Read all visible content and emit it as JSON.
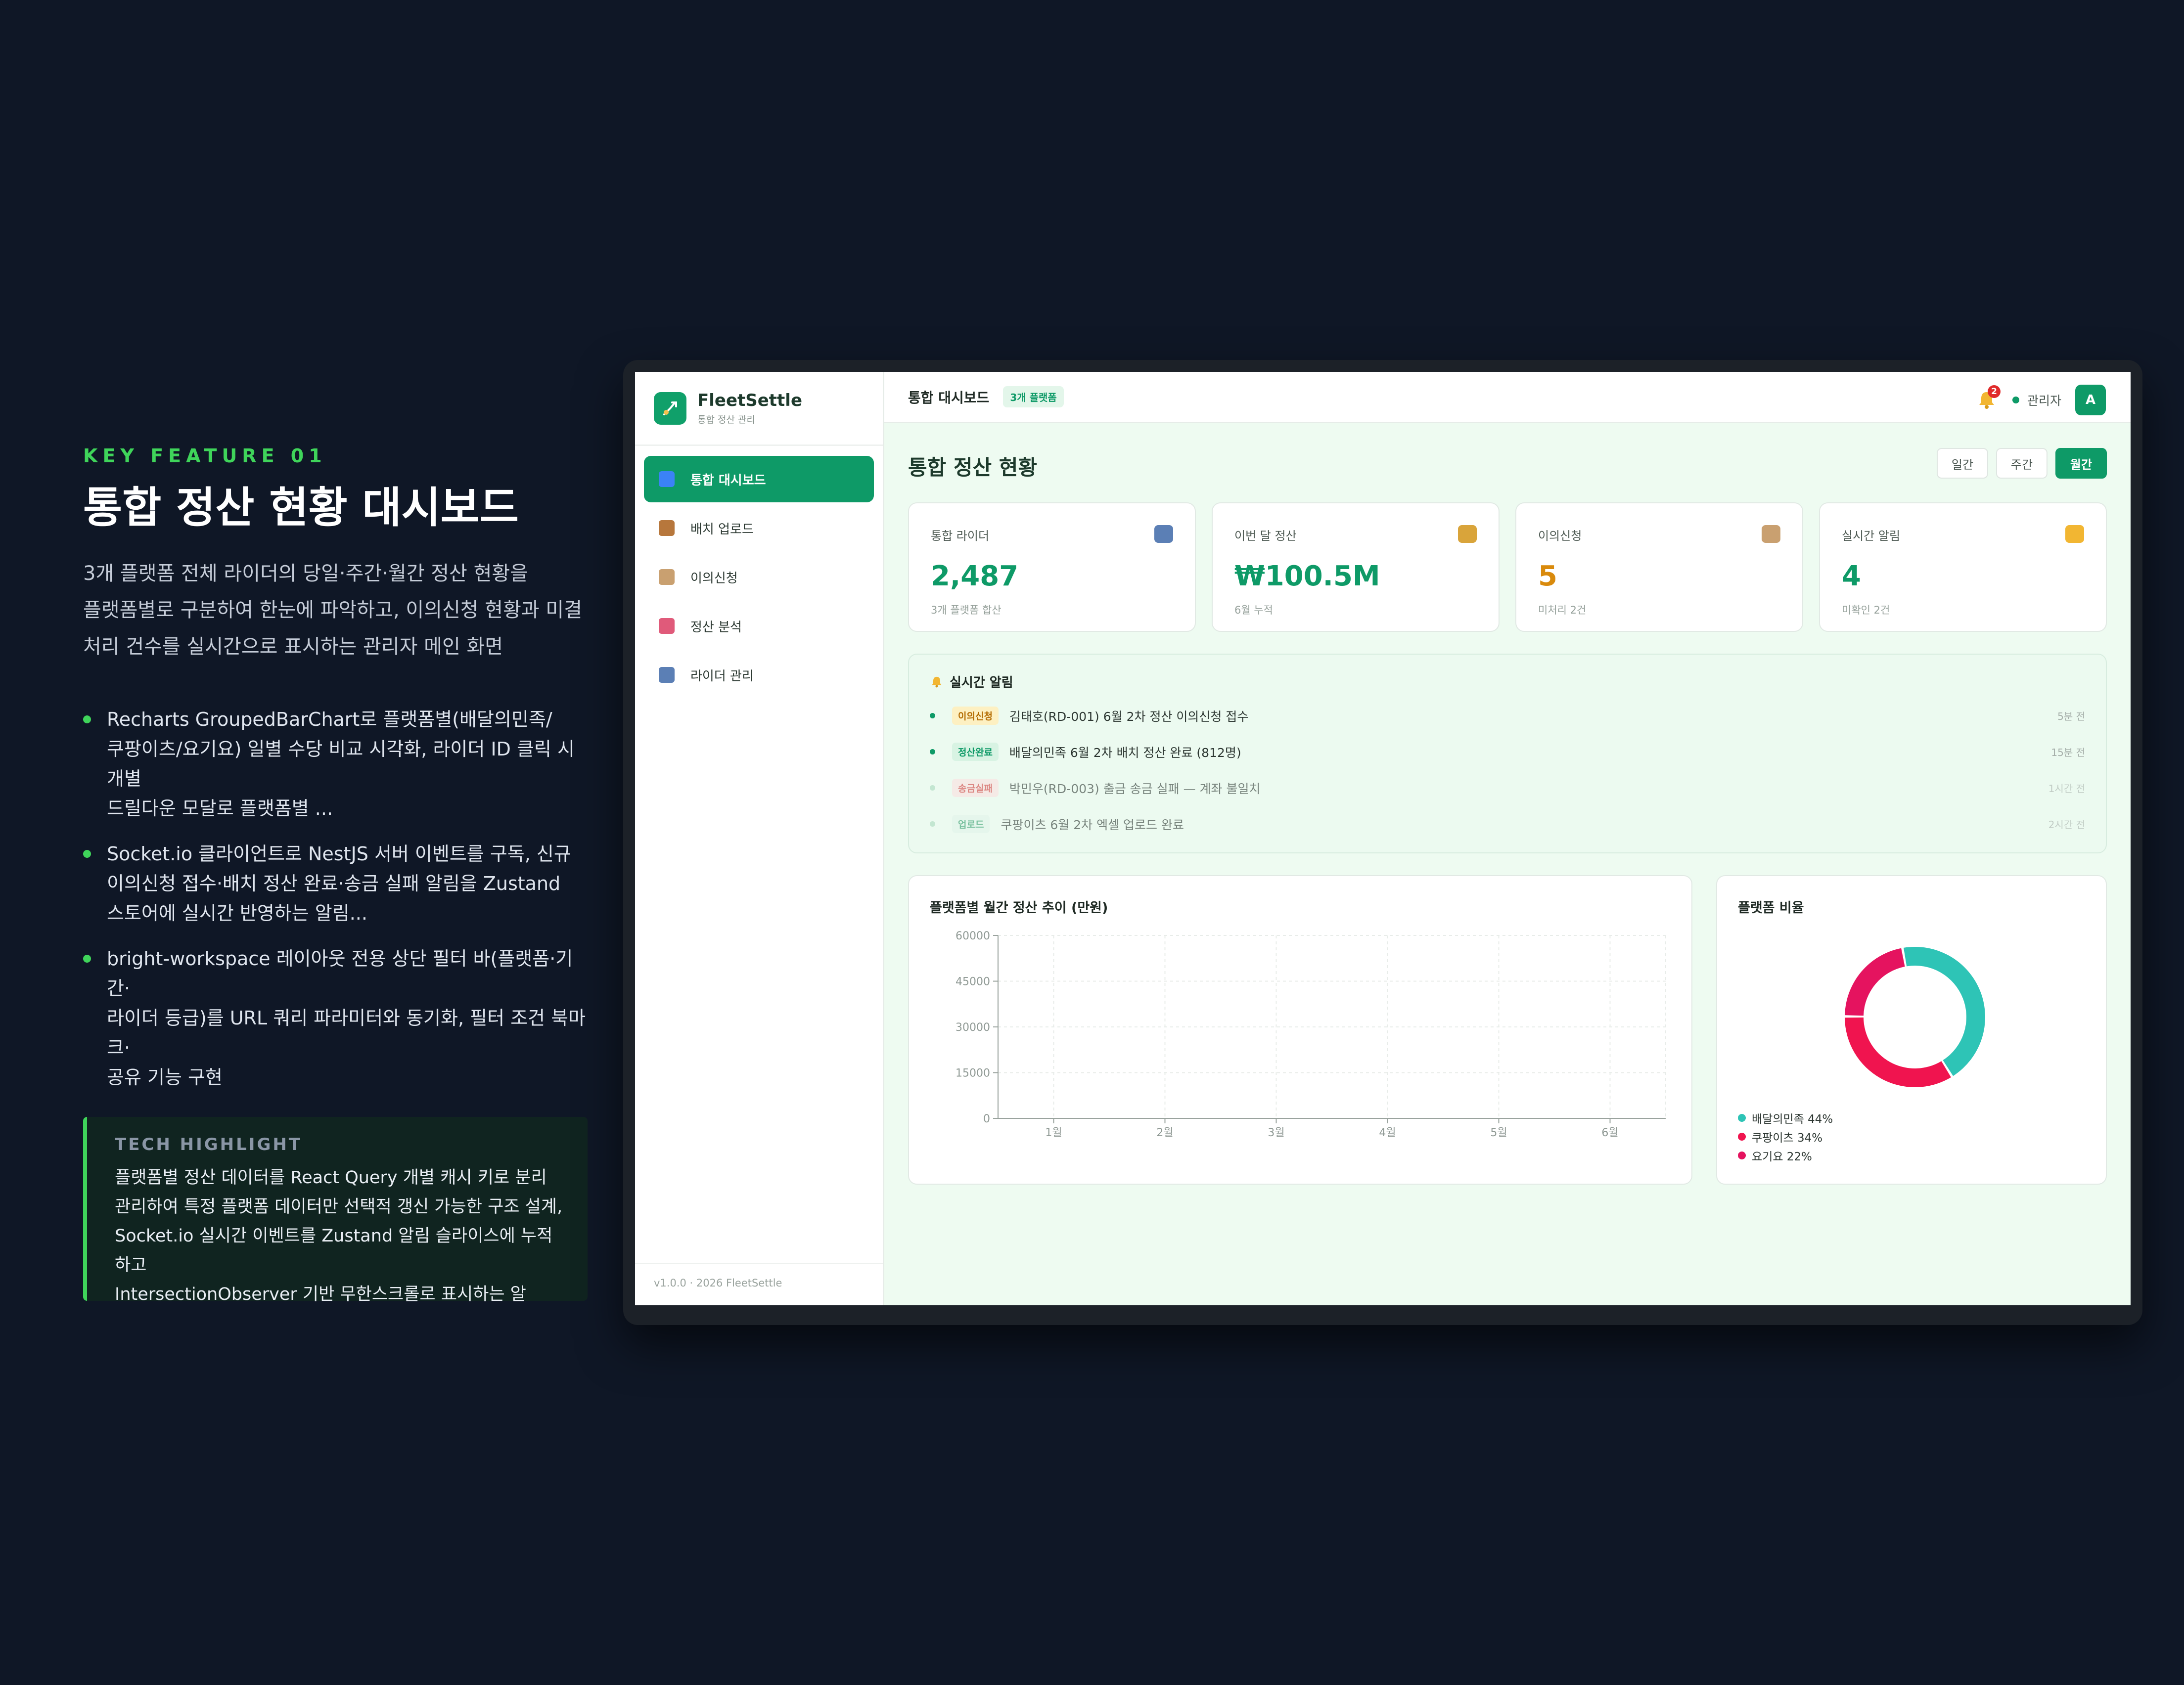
{
  "feature": {
    "kicker": "KEY FEATURE 01",
    "title": "통합 정산 현황 대시보드",
    "desc_lines": [
      "3개 플랫폼 전체 라이더의 당일·주간·월간 정산 현황을",
      "플랫폼별로 구분하여 한눈에 파악하고, 이의신청 현황과 미결",
      "처리 건수를 실시간으로 표시하는 관리자 메인 화면"
    ],
    "bullets": [
      [
        "Recharts GroupedBarChart로 플랫폼별(배달의민족/",
        "쿠팡이츠/요기요) 일별 수당 비교 시각화, 라이더 ID 클릭 시 개별",
        "드릴다운 모달로 플랫폼별 ..."
      ],
      [
        "Socket.io 클라이언트로 NestJS 서버 이벤트를 구독, 신규",
        "이의신청 접수·배치 정산 완료·송금 실패 알림을 Zustand",
        "스토어에 실시간 반영하는 알림..."
      ],
      [
        "bright-workspace 레이아웃 전용 상단 필터 바(플랫폼·기간·",
        "라이더 등급)를 URL 쿼리 파라미터와 동기화, 필터 조건 북마크·",
        "공유 기능 구현"
      ]
    ],
    "tech_title": "TECH HIGHLIGHT",
    "tech_lines": [
      "플랫폼별 정산 데이터를 React Query 개별 캐시 키로 분리",
      "관리하여 특정 플랫폼 데이터만 선택적 갱신 가능한 구조 설계,",
      "Socket.io 실시간 이벤트를 Zustand 알림 슬라이스에 누적하고",
      "IntersectionObserver 기반 무한스크롤로 표시하는 알"
    ]
  },
  "app": {
    "brand": "FleetSettle",
    "brand_sub": "통합 정산 관리",
    "nav": [
      {
        "label": "통합 대시보드",
        "icon": "bar-chart-icon",
        "color": "#3b82f6",
        "active": true
      },
      {
        "label": "배치 업로드",
        "icon": "package-icon",
        "color": "#b7773c",
        "active": false
      },
      {
        "label": "이의신청",
        "icon": "clipboard-icon",
        "color": "#c9a070",
        "active": false
      },
      {
        "label": "정산 분석",
        "icon": "trend-chart-icon",
        "color": "#e05a7a",
        "active": false
      },
      {
        "label": "라이더 관리",
        "icon": "users-icon",
        "color": "#5b7fb5",
        "active": false
      }
    ],
    "footer": "v1.0.0 · 2026 FleetSettle",
    "topbar": {
      "title": "통합 대시보드",
      "badge": "3개 플랫폼",
      "notif_count": "2",
      "user": "관리자",
      "avatar": "A"
    },
    "page_title": "통합 정산 현황",
    "range": [
      {
        "label": "일간",
        "active": false
      },
      {
        "label": "주간",
        "active": false
      },
      {
        "label": "월간",
        "active": true
      }
    ],
    "kpis": [
      {
        "label": "통합 라이더",
        "value": "2,487",
        "sub": "3개 플랫폼 합산",
        "color": "#0e9a67",
        "icon": "users-icon"
      },
      {
        "label": "이번 달 정산",
        "value": "₩100.5M",
        "sub": "6월 누적",
        "color": "#0e9a67",
        "icon": "money-bag-icon"
      },
      {
        "label": "이의신청",
        "value": "5",
        "sub": "미처리 2건",
        "color": "#d98a0c",
        "icon": "clipboard-icon"
      },
      {
        "label": "실시간 알림",
        "value": "4",
        "sub": "미확인 2건",
        "color": "#0e9a67",
        "icon": "bell-icon"
      }
    ],
    "alerts": {
      "title": "실시간 알림",
      "items": [
        {
          "tag": "이의신청",
          "text": "김태호(RD-001) 6월 2차 정산 이의신청 접수",
          "time": "5분 전",
          "tag_bg": "#fdf0c2",
          "tag_fg": "#b36b00",
          "dot": "#0e9a67",
          "muted": false
        },
        {
          "tag": "정산완료",
          "text": "배달의민족 6월 2차 배치 정산 완료 (812명)",
          "time": "15분 전",
          "tag_bg": "#d8f3e3",
          "tag_fg": "#0e9a67",
          "dot": "#0e9a67",
          "muted": false
        },
        {
          "tag": "송금실패",
          "text": "박민우(RD-003) 출금 송금 실패 — 계좌 불일치",
          "time": "1시간 전",
          "tag_bg": "#fbe0e0",
          "tag_fg": "#d23c3c",
          "dot": "#a8d9bd",
          "muted": true
        },
        {
          "tag": "업로드",
          "text": "쿠팡이츠 6월 2차 엑셀 업로드 완료",
          "time": "2시간 전",
          "tag_bg": "#e2f4ea",
          "tag_fg": "#2f9c6a",
          "dot": "#a8d9bd",
          "muted": true
        }
      ]
    }
  },
  "chart_data": [
    {
      "type": "bar",
      "title": "플랫폼별 월간 정산 추이 (만원)",
      "categories": [
        "1월",
        "2월",
        "3월",
        "4월",
        "5월",
        "6월"
      ],
      "yticks": [
        0,
        15000,
        30000,
        45000,
        60000
      ],
      "ylim": [
        0,
        60000
      ],
      "grid": true,
      "series": []
    },
    {
      "type": "pie",
      "title": "플랫폼 비율",
      "slices": [
        {
          "name": "배달의민족 44%",
          "value": 44,
          "color": "#2ec4b6"
        },
        {
          "name": "쿠팡이츠 34%",
          "value": 34,
          "color": "#f0144f"
        },
        {
          "name": "요기요 22%",
          "value": 22,
          "color": "#e5135f"
        }
      ]
    }
  ]
}
